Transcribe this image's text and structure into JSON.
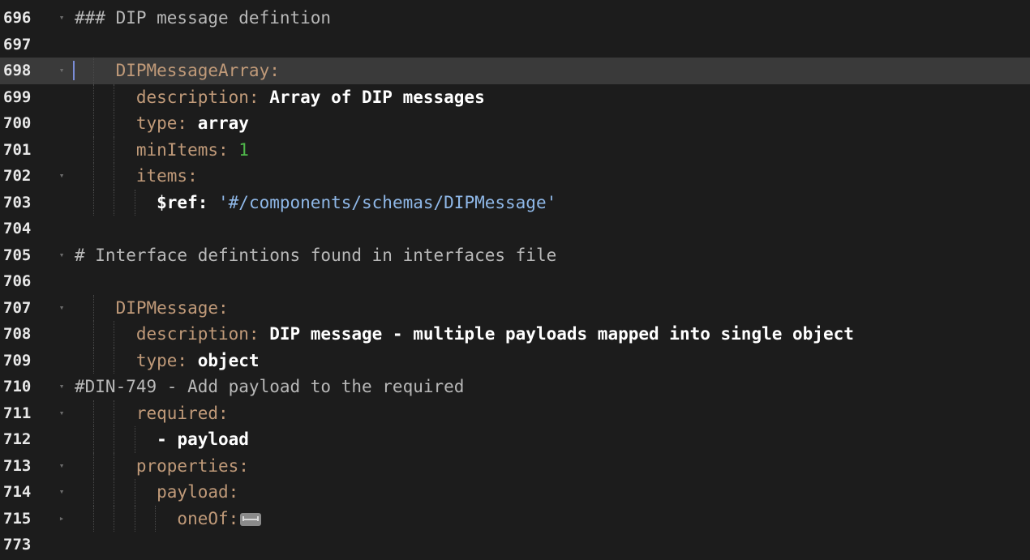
{
  "editor": {
    "lines": [
      {
        "num": "696",
        "fold": "▾",
        "tokens": [
          {
            "t": "### DIP message defintion",
            "c": "comment"
          }
        ]
      },
      {
        "num": "697",
        "fold": "",
        "tokens": []
      },
      {
        "num": "698",
        "fold": "▾",
        "tokens": [
          {
            "t": "    DIPMessageArray:",
            "c": "key"
          }
        ]
      },
      {
        "num": "699",
        "fold": "",
        "tokens": [
          {
            "t": "      description: ",
            "c": "key"
          },
          {
            "t": "Array of DIP messages",
            "c": "plain"
          }
        ]
      },
      {
        "num": "700",
        "fold": "",
        "tokens": [
          {
            "t": "      type: ",
            "c": "key"
          },
          {
            "t": "array",
            "c": "plain"
          }
        ]
      },
      {
        "num": "701",
        "fold": "",
        "tokens": [
          {
            "t": "      minItems: ",
            "c": "key"
          },
          {
            "t": "1",
            "c": "num"
          }
        ]
      },
      {
        "num": "702",
        "fold": "▾",
        "tokens": [
          {
            "t": "      items:",
            "c": "key"
          }
        ]
      },
      {
        "num": "703",
        "fold": "",
        "tokens": [
          {
            "t": "        $ref: ",
            "c": "ref"
          },
          {
            "t": "'#/components/schemas/DIPMessage'",
            "c": "str"
          }
        ]
      },
      {
        "num": "704",
        "fold": "",
        "tokens": []
      },
      {
        "num": "705",
        "fold": "▾",
        "tokens": [
          {
            "t": "# Interface defintions found in interfaces file",
            "c": "comment"
          }
        ]
      },
      {
        "num": "706",
        "fold": "",
        "tokens": []
      },
      {
        "num": "707",
        "fold": "▾",
        "tokens": [
          {
            "t": "    DIPMessage:",
            "c": "key"
          }
        ]
      },
      {
        "num": "708",
        "fold": "",
        "tokens": [
          {
            "t": "      description: ",
            "c": "key"
          },
          {
            "t": "DIP message - multiple payloads mapped into single object",
            "c": "plain"
          }
        ]
      },
      {
        "num": "709",
        "fold": "",
        "tokens": [
          {
            "t": "      type: ",
            "c": "key"
          },
          {
            "t": "object",
            "c": "plain"
          }
        ]
      },
      {
        "num": "710",
        "fold": "▾",
        "tokens": [
          {
            "t": "#DIN-749 - Add payload to the required",
            "c": "comment"
          }
        ]
      },
      {
        "num": "711",
        "fold": "▾",
        "tokens": [
          {
            "t": "      required:",
            "c": "key"
          }
        ]
      },
      {
        "num": "712",
        "fold": "",
        "tokens": [
          {
            "t": "        - ",
            "c": "plain"
          },
          {
            "t": "payload",
            "c": "plain"
          }
        ]
      },
      {
        "num": "713",
        "fold": "▾",
        "tokens": [
          {
            "t": "      properties:",
            "c": "key"
          }
        ]
      },
      {
        "num": "714",
        "fold": "▾",
        "tokens": [
          {
            "t": "        payload:",
            "c": "key"
          }
        ]
      },
      {
        "num": "715",
        "fold": "▸",
        "tokens": [
          {
            "t": "          oneOf:",
            "c": "key"
          }
        ],
        "folded": true
      },
      {
        "num": "773",
        "fold": "",
        "tokens": []
      }
    ],
    "current_line": "698",
    "colors": {
      "background": "#1c1c1c",
      "current_line": "#3a3a3a",
      "key": "#c09a79",
      "comment": "#b8b8b8",
      "number": "#4fb84a",
      "string": "#8fb8e8"
    },
    "icons": {
      "fold_expanded": "chevron-down-icon",
      "fold_collapsed": "chevron-right-icon",
      "folded_block": "ellipsis-fold-icon"
    }
  }
}
